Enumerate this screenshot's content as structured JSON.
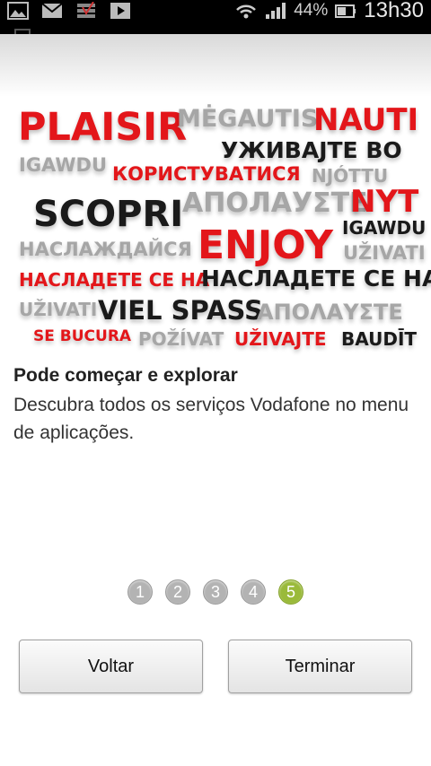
{
  "status_bar": {
    "battery_percent": "44%",
    "time": "13h30",
    "left_icons": [
      "image-icon",
      "gmail-icon",
      "tasks-icon",
      "play-store-icon"
    ],
    "right_icons": [
      "wifi-icon",
      "signal-icon",
      "battery-icon"
    ]
  },
  "word_cloud": [
    {
      "text": "PLAISIR",
      "color": "#e3161a"
    },
    {
      "text": "MĖGAUTIS",
      "color": "#a6a6a6"
    },
    {
      "text": "NAUTI",
      "color": "#e3161a"
    },
    {
      "text": "УЖИВАЈТЕ ВО",
      "color": "#1a1a1a"
    },
    {
      "text": "IGAWDU",
      "color": "#a6a6a6"
    },
    {
      "text": "КОРИСТУВАТИСЯ",
      "color": "#e3161a"
    },
    {
      "text": "NJÓTTU",
      "color": "#a6a6a6"
    },
    {
      "text": "SCOPRI",
      "color": "#1a1a1a"
    },
    {
      "text": "АПОЛАУΣТΕ",
      "color": "#a6a6a6"
    },
    {
      "text": "NYT",
      "color": "#e3161a"
    },
    {
      "text": "IGAWDU",
      "color": "#1a1a1a"
    },
    {
      "text": "НАСЛАЖДАЙСЯ",
      "color": "#a6a6a6"
    },
    {
      "text": "ENJOY",
      "color": "#e3161a"
    },
    {
      "text": "UŽIVATI",
      "color": "#a6a6a6"
    },
    {
      "text": "НАСЛАДЕТЕ СЕ НА",
      "color": "#e3161a"
    },
    {
      "text": "НАСЛАДЕТЕ СЕ НА",
      "color": "#1a1a1a"
    },
    {
      "text": "UŽIVATI",
      "color": "#a6a6a6"
    },
    {
      "text": "VIEL SPASS",
      "color": "#1a1a1a"
    },
    {
      "text": "ΑΠΟΛΑΥΣΤΕ",
      "color": "#a6a6a6"
    },
    {
      "text": "SE BUCURA",
      "color": "#e3161a"
    },
    {
      "text": "POŽÍVAT",
      "color": "#a6a6a6"
    },
    {
      "text": "UŽIVAJTE",
      "color": "#e3161a"
    },
    {
      "text": "BAUDĪT",
      "color": "#1a1a1a"
    }
  ],
  "content": {
    "title": "Pode começar e explorar",
    "description": "Descubra todos os serviços Vodafone no menu de aplicações."
  },
  "pager": {
    "pages": [
      "1",
      "2",
      "3",
      "4",
      "5"
    ],
    "active_page": "5",
    "active_color": "#9aba3a"
  },
  "buttons": {
    "back_label": "Voltar",
    "finish_label": "Terminar"
  }
}
